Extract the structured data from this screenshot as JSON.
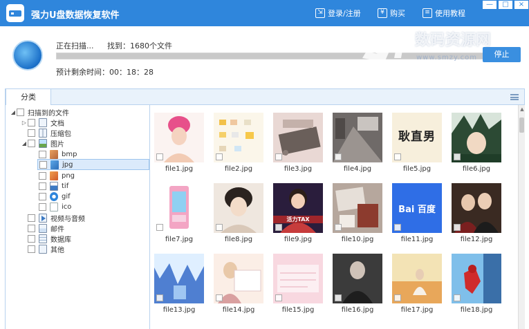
{
  "app": {
    "title": "强力U盘数据恢复软件",
    "login_label": "登录/注册",
    "buy_label": "购买",
    "tutorial_label": "使用教程",
    "minimize_label": "—",
    "maximize_label": "□",
    "close_label": "×"
  },
  "watermark": {
    "big": "数码资源网",
    "small": "www.smzy.com"
  },
  "scan": {
    "status": "正在扫描...",
    "found_label": "找到：1680个文件",
    "progress_percent": 100,
    "remaining_label": "预计剩余时间：00：18：28",
    "stop_label": "停止"
  },
  "tabs": [
    {
      "label": "分类"
    }
  ],
  "tree": {
    "root": "扫描到的文件",
    "items": [
      {
        "label": "文档",
        "icon": "document-icon"
      },
      {
        "label": "压缩包",
        "icon": "archive-icon"
      },
      {
        "label": "图片",
        "icon": "image-folder-icon"
      },
      {
        "label": "bmp",
        "icon": "bmp-icon"
      },
      {
        "label": "jpg",
        "icon": "jpg-icon"
      },
      {
        "label": "png",
        "icon": "png-icon"
      },
      {
        "label": "tif",
        "icon": "tif-icon"
      },
      {
        "label": "gif",
        "icon": "gif-icon"
      },
      {
        "label": "ico",
        "icon": "ico-icon"
      },
      {
        "label": "视频与音频",
        "icon": "video-icon"
      },
      {
        "label": "邮件",
        "icon": "mail-icon"
      },
      {
        "label": "数据库",
        "icon": "database-icon"
      },
      {
        "label": "其他",
        "icon": "other-icon"
      }
    ],
    "selected": "jpg"
  },
  "files": [
    {
      "name": "file1.jpg"
    },
    {
      "name": "file2.jpg"
    },
    {
      "name": "file3.jpg"
    },
    {
      "name": "file4.jpg"
    },
    {
      "name": "file5.jpg"
    },
    {
      "name": "file6.jpg"
    },
    {
      "name": "file7.jpg"
    },
    {
      "name": "file8.jpg"
    },
    {
      "name": "file9.jpg"
    },
    {
      "name": "file10.jpg"
    },
    {
      "name": "file11.jpg"
    },
    {
      "name": "file12.jpg"
    },
    {
      "name": "file13.jpg"
    },
    {
      "name": "file14.jpg"
    },
    {
      "name": "file15.jpg"
    },
    {
      "name": "file16.jpg"
    },
    {
      "name": "file17.jpg"
    },
    {
      "name": "file18.jpg"
    }
  ],
  "thumb_text": {
    "file5": "耿直男",
    "file9": "活力TAX",
    "file11": "Bai 百度"
  },
  "colors": {
    "titlebar": "#2f86dc",
    "accent": "#3a8fe0",
    "tab_border": "#b8d2ee"
  }
}
